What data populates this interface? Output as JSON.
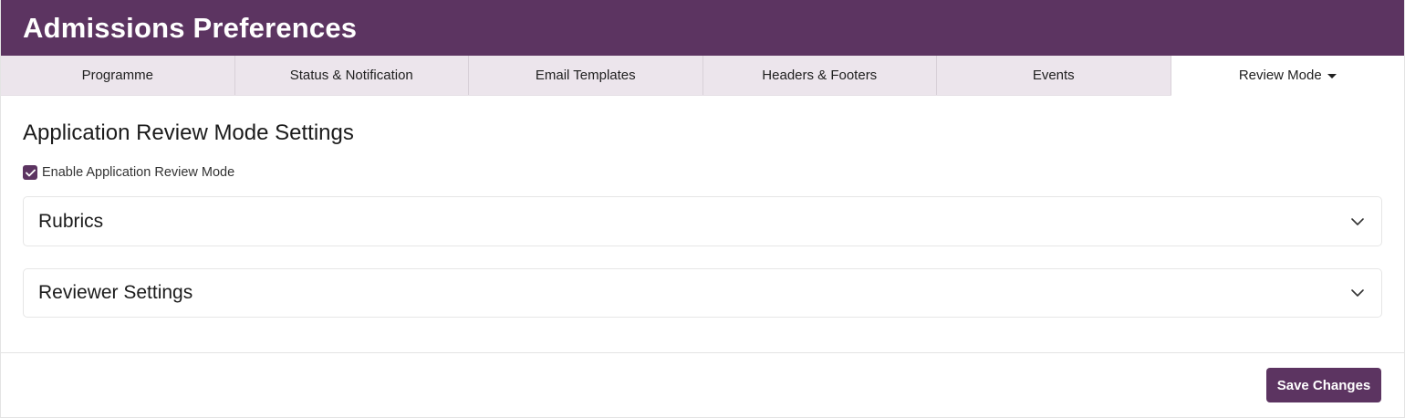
{
  "header": {
    "title": "Admissions Preferences"
  },
  "tabs": [
    {
      "label": "Programme"
    },
    {
      "label": "Status & Notification"
    },
    {
      "label": "Email Templates"
    },
    {
      "label": "Headers & Footers"
    },
    {
      "label": "Events"
    },
    {
      "label": "Review Mode",
      "active": true
    }
  ],
  "main": {
    "section_title": "Application Review Mode Settings",
    "enable_checkbox": {
      "label": "Enable Application Review Mode",
      "checked": true
    },
    "accordions": [
      {
        "title": "Rubrics",
        "icon": "chevron-down-icon"
      },
      {
        "title": "Reviewer Settings",
        "icon": "chevron-down-icon"
      }
    ]
  },
  "footer": {
    "save_label": "Save Changes"
  },
  "colors": {
    "brand": "#5c3461",
    "tab_bg": "#ece5ec",
    "active_tab_bg": "#ffffff"
  }
}
